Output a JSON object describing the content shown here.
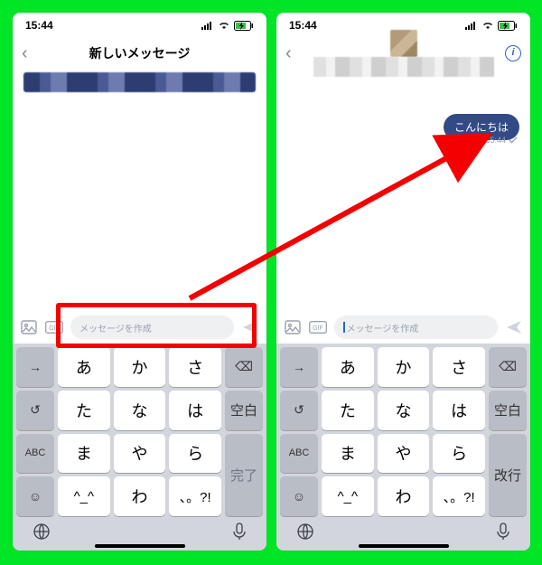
{
  "status": {
    "time": "15:44",
    "battery_icon": "battery-charging"
  },
  "left": {
    "title": "新しいメッセージ",
    "composer_placeholder": "メッセージを作成"
  },
  "right": {
    "bubble_text": "こんにちは",
    "bubble_time": "15:44",
    "composer_placeholder": "メッセージを作成"
  },
  "keyboard": {
    "rows": [
      [
        "→",
        "あ",
        "か",
        "さ",
        "⌫"
      ],
      [
        "↺",
        "た",
        "な",
        "は",
        "空白"
      ],
      [
        "ABC",
        "ま",
        "や",
        "ら",
        "完了"
      ],
      [
        "☺",
        "^_^",
        "わ",
        "、。?!",
        ""
      ]
    ],
    "rows_right_done": "改行"
  }
}
